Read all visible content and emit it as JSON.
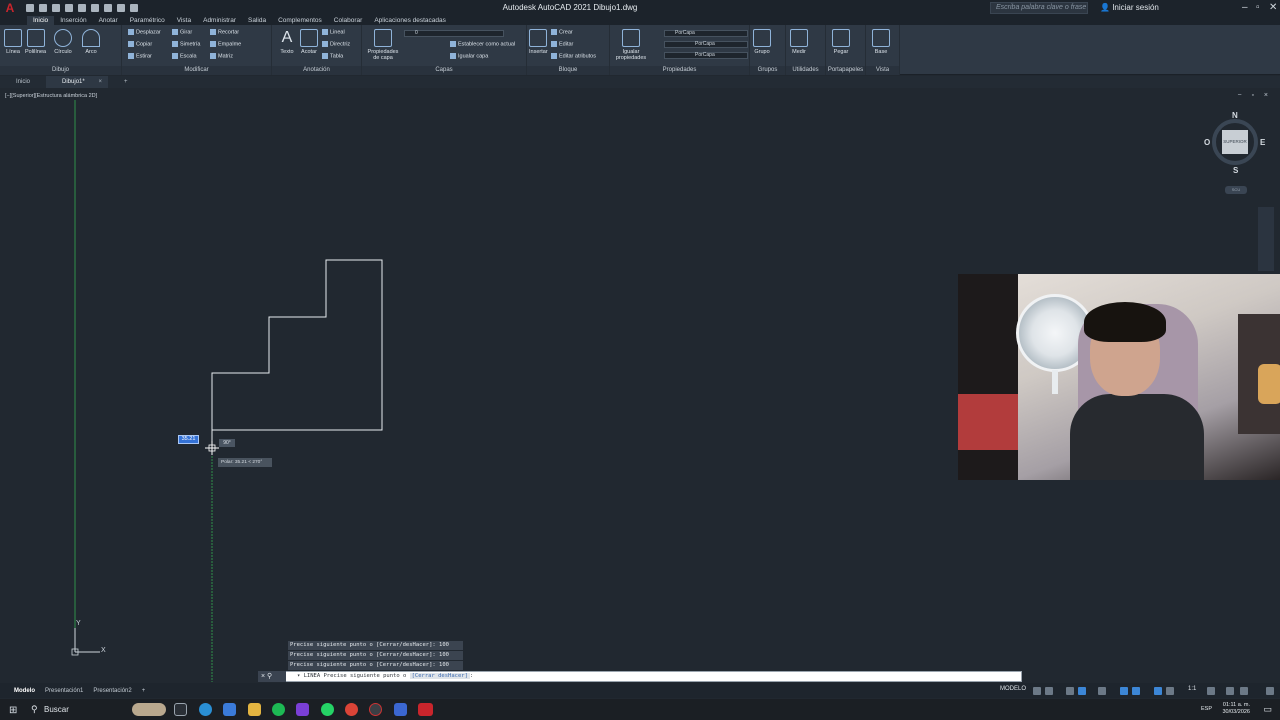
{
  "titlebar": {
    "title": "Autodesk AutoCAD 2021   Dibujo1.dwg",
    "search_placeholder": "Escriba palabra clave o frase",
    "signin": "Iniciar sesión",
    "logo_letter": "A"
  },
  "ribbon_tabs": [
    "Inicio",
    "Inserción",
    "Anotar",
    "Paramétrico",
    "Vista",
    "Administrar",
    "Salida",
    "Complementos",
    "Colaborar",
    "Aplicaciones destacadas"
  ],
  "ribbon": {
    "dibujo": {
      "title": "Dibujo",
      "tools": [
        "Línea",
        "Polilínea",
        "Círculo",
        "Arco"
      ]
    },
    "modificar": {
      "title": "Modificar",
      "tools": [
        "Desplazar",
        "Girar",
        "Recortar",
        "Copiar",
        "Simetría",
        "Empalme",
        "Estirar",
        "Escala",
        "Matriz"
      ]
    },
    "anotacion": {
      "title": "Anotación",
      "tools": [
        "Texto",
        "Acotar",
        "Lineal",
        "Directriz",
        "Tabla"
      ]
    },
    "capas": {
      "title": "Capas",
      "tools": [
        "Propiedades de capa",
        "Establecer como actual",
        "Igualar capa"
      ],
      "layer_value": "0"
    },
    "bloque": {
      "title": "Bloque",
      "tools": [
        "Insertar",
        "Crear",
        "Editar",
        "Editar atributos"
      ]
    },
    "propiedades": {
      "title": "Propiedades",
      "tools": [
        "Igualar propiedades"
      ],
      "color": "PorCapa",
      "linetype": "PorCapa",
      "lineweight": "PorCapa"
    },
    "grupos": {
      "title": "Grupos",
      "tools": [
        "Grupo"
      ]
    },
    "utilidades": {
      "title": "Utilidades",
      "tools": [
        "Medir"
      ]
    },
    "portapapeles": {
      "title": "Portapapeles",
      "tools": [
        "Pegar"
      ]
    },
    "vista": {
      "title": "Vista",
      "tools": [
        "Base"
      ]
    }
  },
  "file_tabs": {
    "start": "Inicio",
    "active": "Dibujo1*",
    "close": "×",
    "add": "+"
  },
  "viewport": {
    "label": "[−][Superior][Estructura alámbrica 2D]",
    "controls": "− ▫ ×"
  },
  "viewcube": {
    "face": "SUPERIOR",
    "north": "N",
    "south": "S",
    "east": "E",
    "west": "O",
    "wcs": "SCU"
  },
  "cursor": {
    "dynamic_input": "35.21",
    "angle": "90°",
    "polar_tooltip": "Polar: 35.21 < 270°"
  },
  "ucs": {
    "x": "X",
    "y": "Y"
  },
  "command": {
    "history": [
      "Precise siguiente punto o [Cerrar/desHacer]: 100",
      "Precise siguiente punto o [Cerrar/desHacer]: 100",
      "Precise siguiente punto o [Cerrar/desHacer]: 100"
    ],
    "prefix": "× ⚲",
    "prompt": "▾ LINEA Precise siguiente punto o ",
    "options": "[Cerrar desHacer]",
    "suffix": ":"
  },
  "statusbar": {
    "layout_tabs": [
      "Modelo",
      "Presentación1",
      "Presentación2"
    ],
    "add": "+",
    "mode": "MODELO",
    "scale": "1:1"
  },
  "taskbar": {
    "search": "Buscar",
    "lang": "ESP",
    "time": "01:11 a. m.",
    "date": "30/03/2026"
  },
  "colors": {
    "accent": "#3472d6",
    "autocad_red": "#c9252c",
    "canvas": "#212830",
    "geometry": "#e8ecef",
    "y_axis": "#2f8f4a"
  }
}
